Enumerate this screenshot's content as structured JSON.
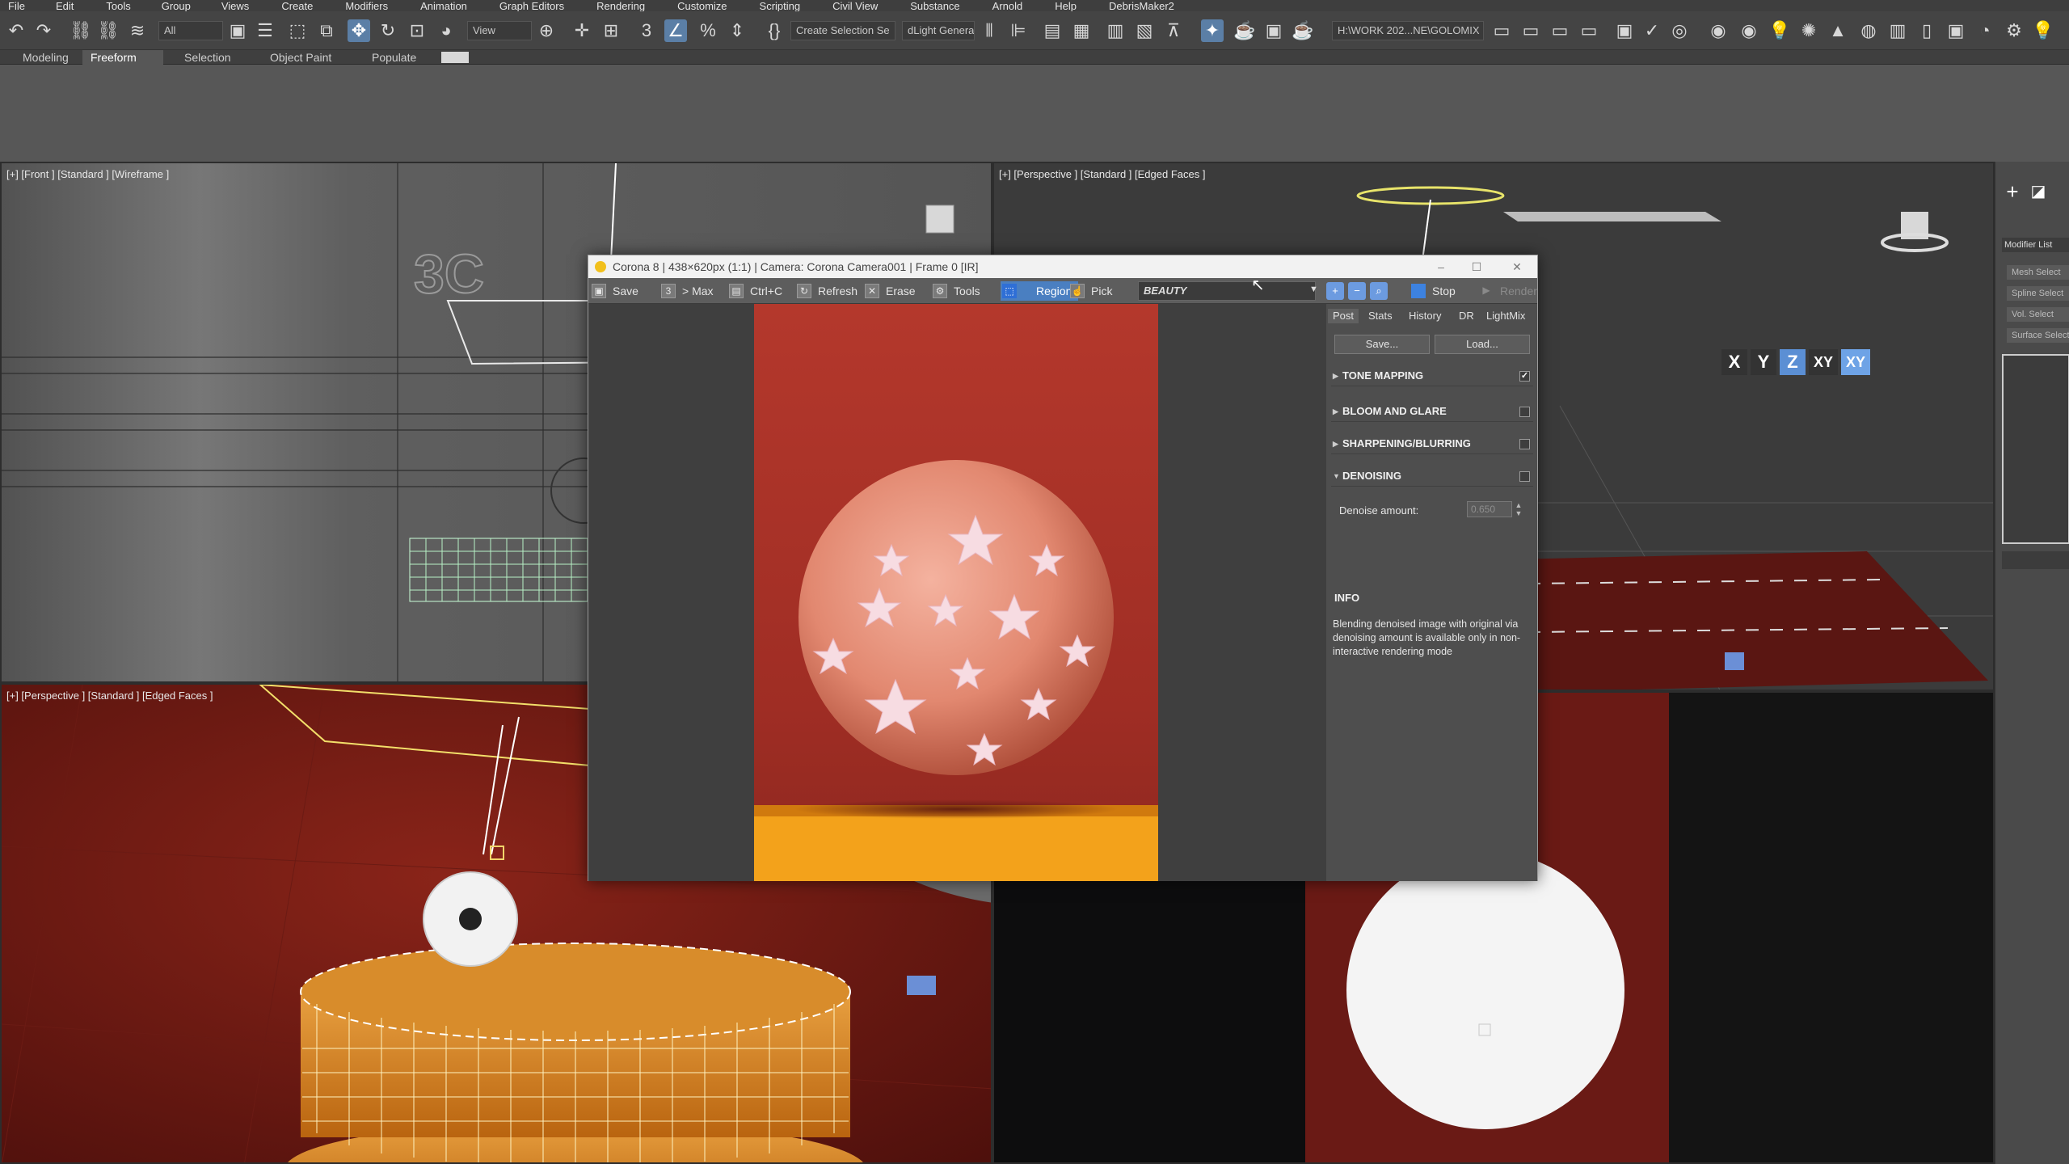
{
  "menu": [
    "File",
    "Edit",
    "Tools",
    "Group",
    "Views",
    "Create",
    "Modifiers",
    "Animation",
    "Graph Editors",
    "Rendering",
    "Customize",
    "Scripting",
    "Civil View",
    "Substance",
    "Arnold",
    "Help",
    "DebrisMaker2"
  ],
  "toolbar": {
    "selection_filter": "All",
    "ref_coord": "View",
    "named_selection": "Create Selection Se",
    "light_generator": "dLight Genera",
    "project_path": "H:\\WORK 202...NE\\GOLOMIX"
  },
  "ribbon": {
    "tabs": [
      "Modeling",
      "Freeform",
      "Selection",
      "Object Paint",
      "Populate"
    ],
    "active": "Freeform"
  },
  "viewports": {
    "front_label": "[+] [Front ] [Standard ] [Wireframe ]",
    "persp_top_label": "[+] [Perspective ] [Standard ] [Edged Faces ]",
    "persp_bottom_label": "[+] [Perspective ] [Standard ] [Edged Faces ]"
  },
  "axis_constraints": [
    "X",
    "Y",
    "Z",
    "XY",
    "XY"
  ],
  "command_panel": {
    "modifier_list": "Modifier List",
    "items": [
      "Mesh Select",
      "Spline Select",
      "Vol. Select",
      "Surface Select"
    ]
  },
  "vfb": {
    "title": "Corona 8 | 438×620px (1:1) | Camera: Corona Camera001 | Frame 0 [IR]",
    "toolbar": {
      "save": "Save",
      "max": "> Max",
      "ctrlc": "Ctrl+C",
      "refresh": "Refresh",
      "erase": "Erase",
      "tools": "Tools",
      "region": "Region",
      "pick": "Pick",
      "pass": "BEAUTY",
      "stop": "Stop",
      "render": "Render"
    },
    "tabs": [
      "Post",
      "Stats",
      "History",
      "DR",
      "LightMix"
    ],
    "active_tab": "Post",
    "buttons": {
      "save": "Save...",
      "load": "Load..."
    },
    "sections": [
      {
        "label": "TONE MAPPING",
        "checked": true
      },
      {
        "label": "BLOOM AND GLARE",
        "checked": false
      },
      {
        "label": "SHARPENING/BLURRING",
        "checked": false
      },
      {
        "label": "DENOISING",
        "checked": false
      }
    ],
    "denoise_label": "Denoise amount:",
    "denoise_value": "0.650",
    "info_heading": "INFO",
    "info_text": "Blending denoised image with original via denoising amount is available only in non-interactive rendering mode"
  }
}
